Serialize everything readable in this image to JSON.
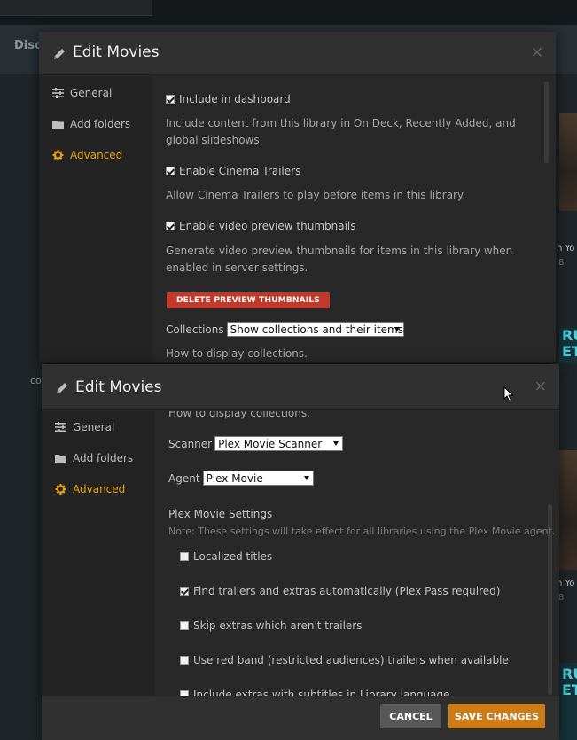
{
  "background": {
    "disco_text": "Disco",
    "disco_text_2": "co",
    "poster_captions": [
      "n Yo",
      "n Yo"
    ],
    "poster_numbers": [
      "8",
      "8"
    ],
    "teal_letters": [
      "RU",
      "ET",
      "RU",
      "ET"
    ]
  },
  "modal_top": {
    "title": "Edit Movies",
    "close": "×",
    "sidebar": [
      {
        "label": "General",
        "icon": "sliders-icon"
      },
      {
        "label": "Add folders",
        "icon": "folder-icon"
      },
      {
        "label": "Advanced",
        "icon": "gear-icon",
        "active": true
      }
    ],
    "include_dashboard": {
      "label": "Include in dashboard",
      "checked": true
    },
    "include_dashboard_desc": "Include content from this library in On Deck, Recently Added, and global slideshows.",
    "cinema_trailers": {
      "label": "Enable Cinema Trailers",
      "checked": true
    },
    "cinema_trailers_desc": "Allow Cinema Trailers to play before items in this library.",
    "preview_thumbs": {
      "label": "Enable video preview thumbnails",
      "checked": true
    },
    "preview_thumbs_desc": "Generate video preview thumbnails for items in this library when enabled in server settings.",
    "delete_button": "DELETE PREVIEW THUMBNAILS",
    "collections_label": "Collections",
    "collections_value": "Show collections and their items",
    "collections_desc": "How to display collections."
  },
  "modal_bottom": {
    "title": "Edit Movies",
    "close": "×",
    "sidebar": [
      {
        "label": "General",
        "icon": "sliders-icon"
      },
      {
        "label": "Add folders",
        "icon": "folder-icon"
      },
      {
        "label": "Advanced",
        "icon": "gear-icon",
        "active": true
      }
    ],
    "collections_desc": "How to display collections.",
    "scanner_label": "Scanner",
    "scanner_value": "Plex Movie Scanner",
    "agent_label": "Agent",
    "agent_value": "Plex Movie",
    "settings_title": "Plex Movie Settings",
    "settings_note": "Note: These settings will take effect for all libraries using the Plex Movie agent.",
    "options": [
      {
        "label": "Localized titles",
        "checked": false
      },
      {
        "label": "Find trailers and extras automatically (Plex Pass required)",
        "checked": true
      },
      {
        "label": "Skip extras which aren't trailers",
        "checked": false
      },
      {
        "label": "Use red band (restricted audiences) trailers when available",
        "checked": false
      },
      {
        "label": "Include extras with subtitles in Library language",
        "checked": false
      }
    ],
    "cancel": "CANCEL",
    "save": "SAVE CHANGES"
  },
  "colors": {
    "accent": "#e5a00d",
    "danger": "#c0392b",
    "save": "#cc7b19"
  }
}
